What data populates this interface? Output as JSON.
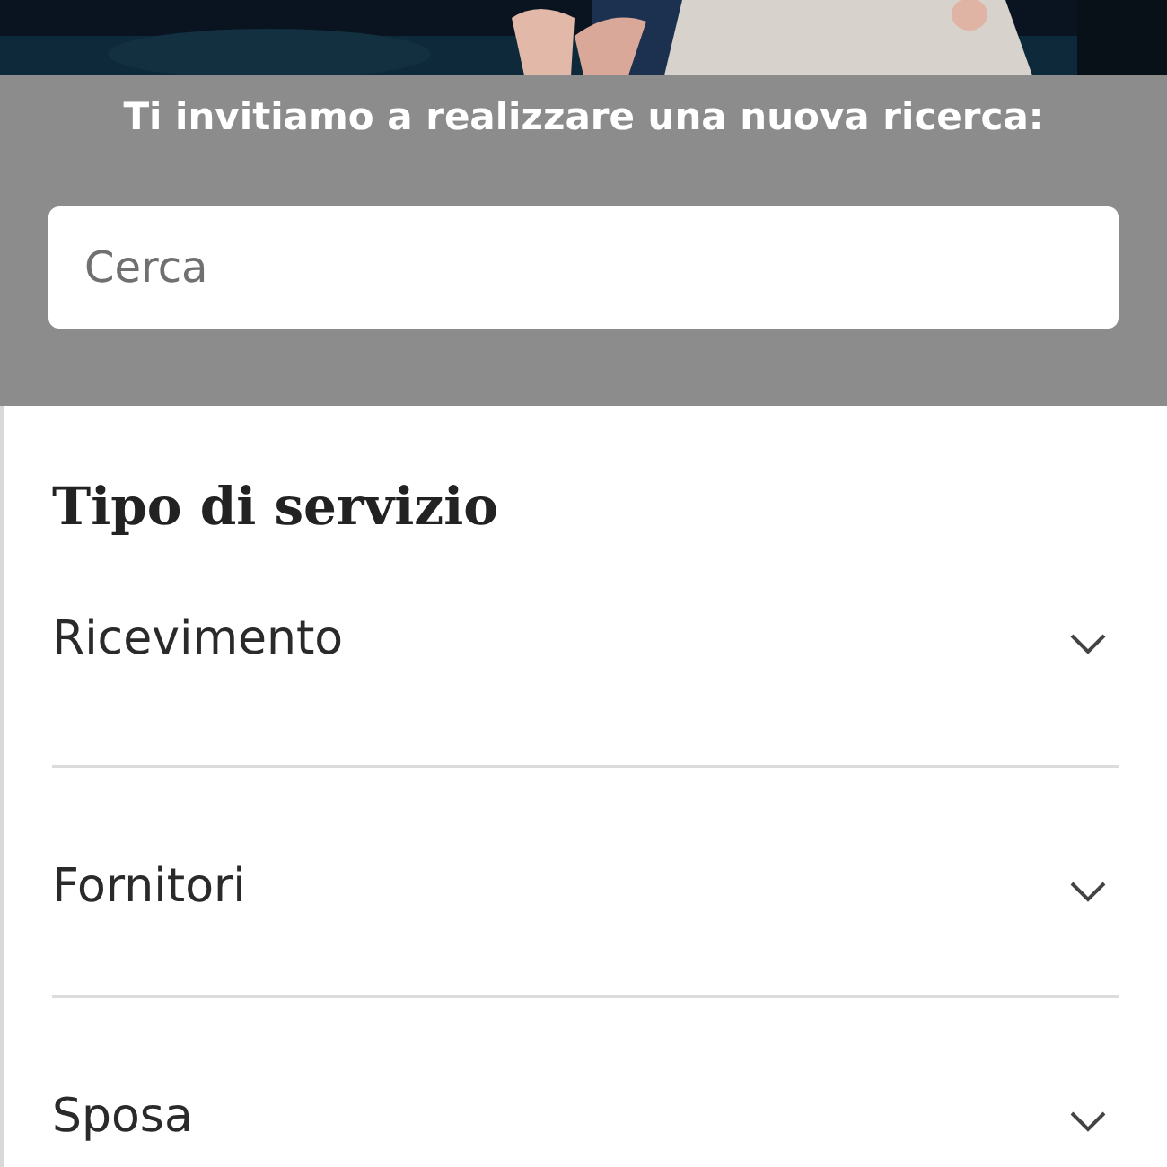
{
  "search_panel": {
    "prompt": "Ti invitiamo a realizzare una nuova ricerca:",
    "search": {
      "placeholder": "Cerca"
    }
  },
  "filter": {
    "title": "Tipo di servizio",
    "items": [
      {
        "label": "Ricevimento",
        "expanded": false
      },
      {
        "label": "Fornitori",
        "expanded": false
      },
      {
        "label": "Sposa",
        "expanded": false
      }
    ]
  }
}
